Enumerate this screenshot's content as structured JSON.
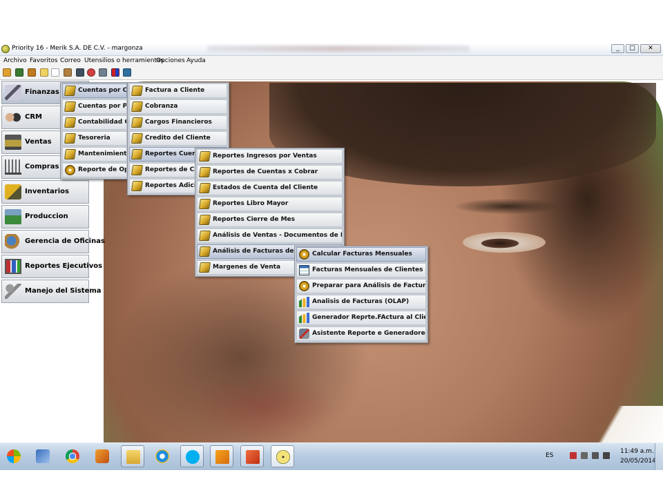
{
  "window": {
    "title": "Priority 16 - Merik S.A. DE C.V. - margonza"
  },
  "menubar": [
    "Archivo",
    "Favoritos",
    "Correo",
    "Utensilios o herramientas",
    "Opciones",
    "Ayuda"
  ],
  "modules": [
    {
      "label": "Finanzas",
      "icon": "finance-icon"
    },
    {
      "label": "CRM",
      "icon": "handshake-icon"
    },
    {
      "label": "Ventas",
      "icon": "cash-register-icon"
    },
    {
      "label": "Compras",
      "icon": "shopping-cart-icon"
    },
    {
      "label": "Inventarios",
      "icon": "forklift-icon"
    },
    {
      "label": "Produccion",
      "icon": "factory-icon"
    },
    {
      "label": "Gerencia de Oficinas",
      "icon": "office-globe-icon"
    },
    {
      "label": "Reportes Ejecutivos",
      "icon": "chart-board-icon"
    },
    {
      "label": "Manejo del Sistema",
      "icon": "keys-icon"
    }
  ],
  "menu_finanzas": [
    {
      "label": "Cuentas por Cobrar",
      "icon": "folder-icon"
    },
    {
      "label": "Cuentas por Pagar",
      "icon": "folder-icon"
    },
    {
      "label": "Contabilidad General",
      "icon": "folder-icon"
    },
    {
      "label": "Tesoreria",
      "icon": "folder-icon"
    },
    {
      "label": "Mantenimiento de",
      "icon": "folder-icon"
    },
    {
      "label": "Reporte de Operaciones",
      "icon": "gear-icon"
    }
  ],
  "menu_cxc": [
    {
      "label": "Factura a Cliente",
      "icon": "folder-icon"
    },
    {
      "label": "Cobranza",
      "icon": "folder-icon"
    },
    {
      "label": "Cargos Financieros",
      "icon": "folder-icon"
    },
    {
      "label": "Credito del Cliente",
      "icon": "folder-icon"
    },
    {
      "label": "Reportes Cuentas",
      "icon": "folder-icon"
    },
    {
      "label": "Reportes de CxC",
      "icon": "folder-icon"
    },
    {
      "label": "Reportes Adicionales",
      "icon": "folder-icon"
    }
  ],
  "menu_reportes": [
    {
      "label": "Reportes Ingresos por Ventas",
      "icon": "folder-icon"
    },
    {
      "label": "Reportes de Cuentas x Cobrar",
      "icon": "folder-icon"
    },
    {
      "label": "Estados de Cuenta del Cliente",
      "icon": "folder-icon"
    },
    {
      "label": "Reportes Libro Mayor",
      "icon": "folder-icon"
    },
    {
      "label": "Reportes Cierre de Mes",
      "icon": "folder-icon"
    },
    {
      "label": "Análisis de Ventas - Documentos de Embarque",
      "icon": "folder-icon"
    },
    {
      "label": "Análisis de Facturas de Clientes",
      "icon": "folder-icon"
    },
    {
      "label": "Margenes de Venta",
      "icon": "folder-icon"
    }
  ],
  "menu_analisis": [
    {
      "label": "Calcular Facturas Mensuales",
      "icon": "gear-icon"
    },
    {
      "label": "Facturas Mensuales de Clientes",
      "icon": "table-icon"
    },
    {
      "label": "Preparar para Análisis de Facturas-OLAP",
      "icon": "gear-icon"
    },
    {
      "label": "Analisis de Facturas (OLAP)",
      "icon": "chart-icon"
    },
    {
      "label": "Generador Reprte.FActura al Cliente",
      "icon": "chart-icon"
    },
    {
      "label": "Asistente Reporte e Generadores",
      "icon": "tools-icon"
    }
  ],
  "taskbar": {
    "apps": [
      "start-icon",
      "network-folder-icon",
      "chrome-icon",
      "media-player-icon",
      "file-explorer-icon",
      "internet-explorer-icon",
      "skype-icon",
      "outlook-icon",
      "powerpoint-icon",
      "priority-clock-icon"
    ],
    "language": "ES",
    "time": "11:49 a.m.",
    "date": "20/05/2014"
  }
}
